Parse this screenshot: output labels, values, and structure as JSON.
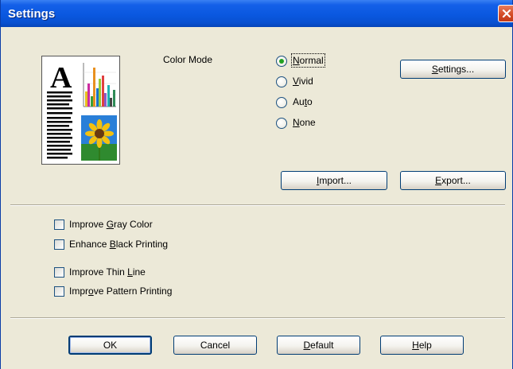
{
  "window": {
    "title": "Settings",
    "close_icon": "close-x-icon"
  },
  "preview": {
    "icon": "document-preview-with-chart-and-sunflower",
    "letter": "A"
  },
  "color_mode": {
    "label": "Color Mode",
    "options": [
      {
        "pre": "",
        "key": "N",
        "post": "ormal",
        "selected": true
      },
      {
        "pre": "",
        "key": "V",
        "post": "ivid",
        "selected": false
      },
      {
        "pre": "Au",
        "key": "t",
        "post": "o",
        "selected": false
      },
      {
        "pre": "",
        "key": "N",
        "post": "one",
        "selected": false
      }
    ]
  },
  "buttons": {
    "settings": {
      "pre": "",
      "key": "S",
      "post": "ettings..."
    },
    "import": {
      "pre": "",
      "key": "I",
      "post": "mport..."
    },
    "export": {
      "pre": "",
      "key": "E",
      "post": "xport..."
    },
    "ok": {
      "pre": "",
      "key": "",
      "post": "OK"
    },
    "cancel": {
      "pre": "",
      "key": "",
      "post": "Cancel"
    },
    "default": {
      "pre": "",
      "key": "D",
      "post": "efault"
    },
    "help": {
      "pre": "",
      "key": "H",
      "post": "elp"
    }
  },
  "checkboxes": [
    {
      "pre": "Improve ",
      "key": "G",
      "post": "ray Color",
      "checked": false
    },
    {
      "pre": "Enhance ",
      "key": "B",
      "post": "lack Printing",
      "checked": false
    },
    {
      "pre": "Improve Thin ",
      "key": "L",
      "post": "ine",
      "checked": false
    },
    {
      "pre": "Impr",
      "key": "o",
      "post": "ve Pattern Printing",
      "checked": false
    }
  ],
  "colors": {
    "title_bar": "#0a58e0",
    "dialog_bg": "#ece9d8",
    "radio_selected": "#21a121",
    "close_button": "#d24a24"
  }
}
